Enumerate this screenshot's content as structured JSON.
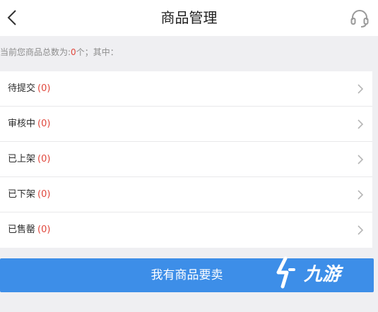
{
  "header": {
    "title": "商品管理",
    "back_icon": "back-arrow-icon",
    "support_icon": "headset-icon"
  },
  "summary": {
    "prefix": "当前您商品总数为:",
    "count": "0",
    "suffix": "个；其中："
  },
  "status_list": [
    {
      "label": "待提交",
      "count": "(0)"
    },
    {
      "label": "审核中",
      "count": "(0)"
    },
    {
      "label": "已上架",
      "count": "(0)"
    },
    {
      "label": "已下架",
      "count": "(0)"
    },
    {
      "label": "已售罄",
      "count": "(0)"
    }
  ],
  "actions": {
    "sell_label": "我有商品要卖"
  },
  "watermark": {
    "text": "九游"
  },
  "colors": {
    "accent": "#3d8ee8",
    "count": "#e0463b",
    "background": "#efeff2"
  }
}
